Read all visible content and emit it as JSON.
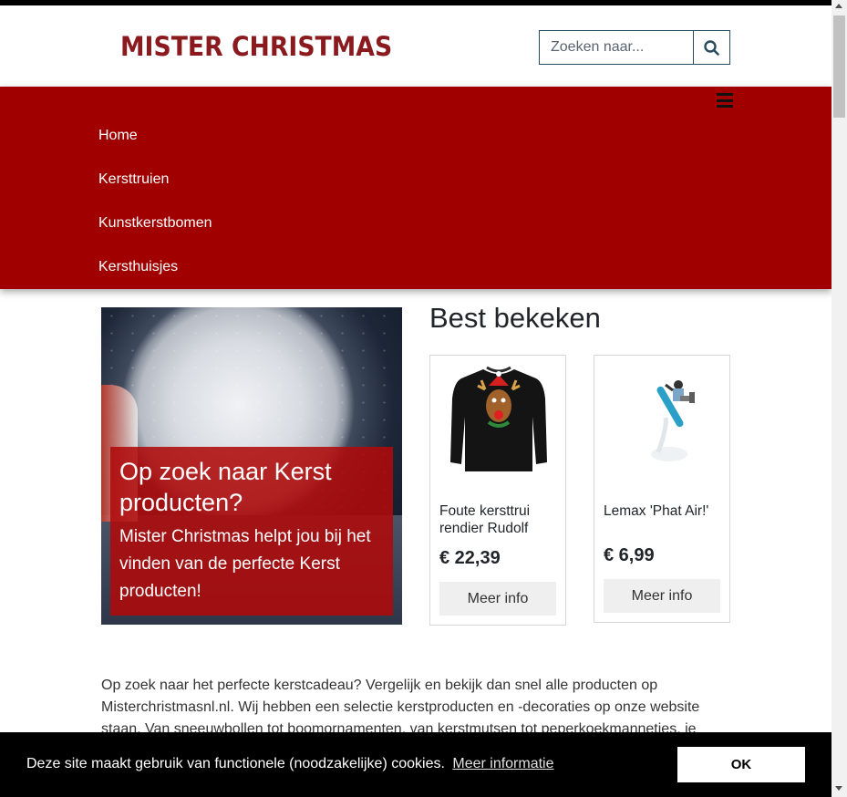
{
  "header": {
    "brand": "MISTER CHRISTMAS",
    "search_placeholder": "Zoeken naar...",
    "brand_color": "#8b1a1f"
  },
  "nav": {
    "menu_icon": "hamburger-icon",
    "items": [
      {
        "label": "Home"
      },
      {
        "label": "Kersttruien"
      },
      {
        "label": "Kunstkerstbomen"
      },
      {
        "label": "Kersthuisjes"
      }
    ],
    "background_color": "#a00000"
  },
  "hero": {
    "title": "Op zoek naar Kerst producten?",
    "text": "Mister Christmas helpt jou bij het vinden van de perfecte Kerst producten!"
  },
  "best_viewed": {
    "title": "Best bekeken",
    "products": [
      {
        "name": "Foute kersttrui rendier Rudolf",
        "price": "€ 22,39",
        "button": "Meer info",
        "image_icon": "reindeer-sweater-image"
      },
      {
        "name": "Lemax 'Phat Air!'",
        "price": "€ 6,99",
        "button": "Meer info",
        "image_icon": "snowboarder-figure-image"
      }
    ]
  },
  "intro": {
    "text": "Op zoek naar het perfecte kerstcadeau? Vergelijk en bekijk dan snel alle producten op Misterchristmasnl.nl. Wij hebben een selectie kerstproducten en -decoraties op onze website staan. Van sneeuwbollen tot boomornamenten, van kerstmutsen tot peperkoekmannetjes, je"
  },
  "cookie": {
    "text": "Deze site maakt gebruik van functionele (noodzakelijke) cookies.",
    "link": "Meer informatie",
    "ok": "OK"
  }
}
